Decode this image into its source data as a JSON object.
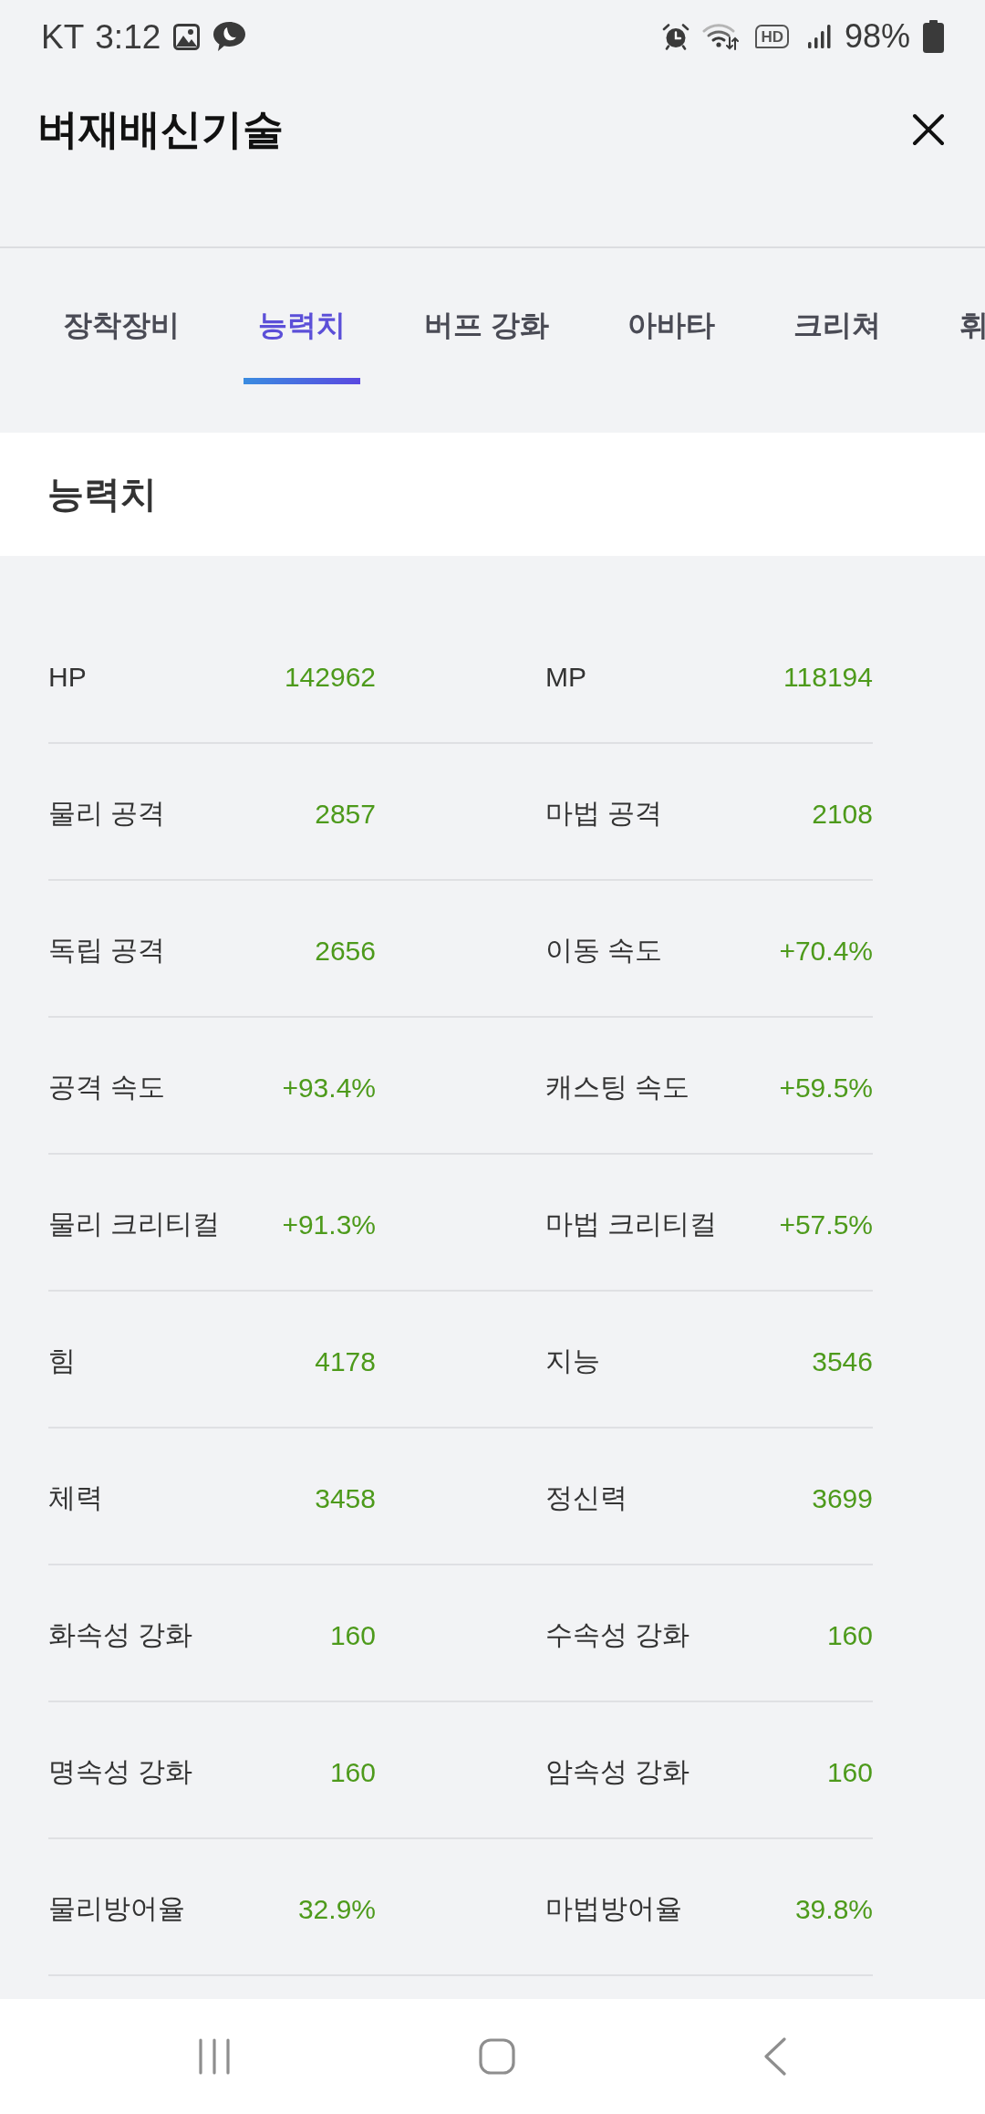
{
  "status_bar": {
    "carrier": "KT",
    "time": "3:12",
    "hd_label": "HD",
    "battery": "98%"
  },
  "header": {
    "title": "벼재배신기술"
  },
  "tabs": [
    {
      "label": "장착장비",
      "selected": false
    },
    {
      "label": "능력치",
      "selected": true
    },
    {
      "label": "버프 강화",
      "selected": false
    },
    {
      "label": "아바타",
      "selected": false
    },
    {
      "label": "크리쳐",
      "selected": false
    },
    {
      "label": "휘",
      "selected": false
    }
  ],
  "section": {
    "title": "능력치"
  },
  "stat_rows": [
    {
      "cells": [
        {
          "label": "HP",
          "value": "142962"
        },
        {
          "label": "MP",
          "value": "118194"
        }
      ]
    },
    {
      "cells": [
        {
          "label": "물리 공격",
          "value": "2857"
        },
        {
          "label": "마법 공격",
          "value": "2108"
        }
      ]
    },
    {
      "cells": [
        {
          "label": "독립 공격",
          "value": "2656"
        },
        {
          "label": "이동 속도",
          "value": "+70.4%"
        }
      ]
    },
    {
      "cells": [
        {
          "label": "공격 속도",
          "value": "+93.4%"
        },
        {
          "label": "캐스팅 속도",
          "value": "+59.5%"
        }
      ]
    },
    {
      "cells": [
        {
          "label": "물리 크리티컬",
          "value": "+91.3%"
        },
        {
          "label": "마법 크리티컬",
          "value": "+57.5%"
        }
      ]
    },
    {
      "cells": [
        {
          "label": "힘",
          "value": "4178"
        },
        {
          "label": "지능",
          "value": "3546"
        }
      ]
    },
    {
      "cells": [
        {
          "label": "체력",
          "value": "3458"
        },
        {
          "label": "정신력",
          "value": "3699"
        }
      ]
    },
    {
      "cells": [
        {
          "label": "화속성 강화",
          "value": "160"
        },
        {
          "label": "수속성 강화",
          "value": "160"
        }
      ]
    },
    {
      "cells": [
        {
          "label": "명속성 강화",
          "value": "160"
        },
        {
          "label": "암속성 강화",
          "value": "160"
        }
      ]
    },
    {
      "cells": [
        {
          "label": "물리방어율",
          "value": "32.9%"
        },
        {
          "label": "마법방어율",
          "value": "39.8%"
        }
      ]
    }
  ]
}
